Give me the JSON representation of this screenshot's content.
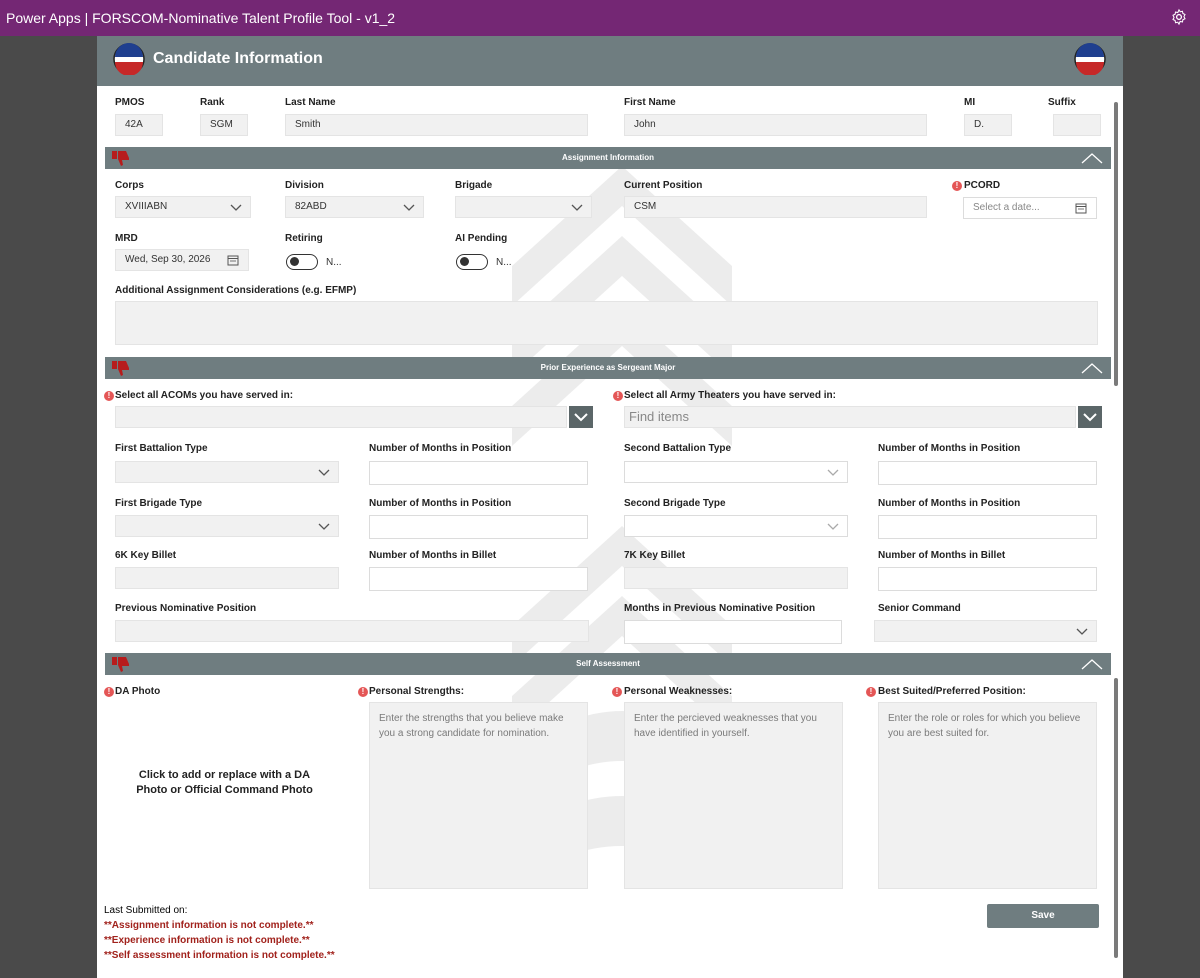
{
  "app": {
    "title": "Power Apps  |  FORSCOM-Nominative Talent Profile Tool - v1_2",
    "settings_icon": "gear-icon"
  },
  "header": {
    "title": "Candidate Information",
    "logo_icon": "flag-roundel-icon"
  },
  "identity": {
    "pmos_label": "PMOS",
    "pmos_value": "42A",
    "rank_label": "Rank",
    "rank_value": "SGM",
    "last_name_label": "Last Name",
    "last_name_value": "Smith",
    "first_name_label": "First Name",
    "first_name_value": "John",
    "mi_label": "MI",
    "mi_value": "D.",
    "suffix_label": "Suffix",
    "suffix_value": ""
  },
  "assignment": {
    "section_title": "Assignment Information",
    "corps_label": "Corps",
    "corps_value": "XVIIIABN",
    "division_label": "Division",
    "division_value": "82ABD",
    "brigade_label": "Brigade",
    "brigade_value": "",
    "position_label": "Current Position",
    "position_value": "CSM",
    "pcord_label": "PCORD",
    "pcord_placeholder": "Select a date...",
    "mrd_label": "MRD",
    "mrd_value": "Wed, Sep 30, 2026",
    "retiring_label": "Retiring",
    "retiring_state": "N...",
    "ai_pending_label": "AI Pending",
    "ai_pending_state": "N...",
    "considerations_label": "Additional Assignment Considerations (e.g. EFMP)",
    "considerations_value": ""
  },
  "experience": {
    "section_title": "Prior Experience as Sergeant Major",
    "acoms_label": "Select all ACOMs you have served in:",
    "theaters_label": "Select all Army Theaters you have served in:",
    "theaters_placeholder": "Find items",
    "first_bn_label": "First Battalion Type",
    "months_position_label": "Number of Months in Position",
    "second_bn_label": "Second Battalion Type",
    "first_bde_label": "First Brigade Type",
    "second_bde_label": "Second Brigade Type",
    "key_6k_label": "6K Key Billet",
    "months_billet_label": "Number of Months in Billet",
    "key_7k_label": "7K Key Billet",
    "prev_nom_label": "Previous Nominative Position",
    "months_prev_nom_label": "Months in Previous Nominative Position",
    "senior_cmd_label": "Senior Command"
  },
  "self_assessment": {
    "section_title": "Self Assessment",
    "photo_label": "DA Photo",
    "photo_prompt": "Click to add or replace with a DA Photo or Official Command Photo",
    "strengths_label": "Personal Strengths:",
    "strengths_placeholder": "Enter the strengths that you believe make you a strong candidate for nomination.",
    "weaknesses_label": "Personal Weaknesses:",
    "weaknesses_placeholder": "Enter the percieved weaknesses that you have identified in yourself.",
    "best_label": "Best Suited/Preferred Position:",
    "best_placeholder": "Enter the role or roles for which you believe you are best suited for."
  },
  "footer": {
    "last_submitted": "Last Submitted on:",
    "err_assignment": "**Assignment information is not complete.**",
    "err_experience": "**Experience information is not complete.**",
    "err_self": "**Self assessment information is not complete.**",
    "save_label": "Save"
  },
  "colors": {
    "titlebar": "#742774",
    "section_bar": "#6f7d80",
    "error_text": "#a1221c",
    "required_badge": "#e45656"
  }
}
